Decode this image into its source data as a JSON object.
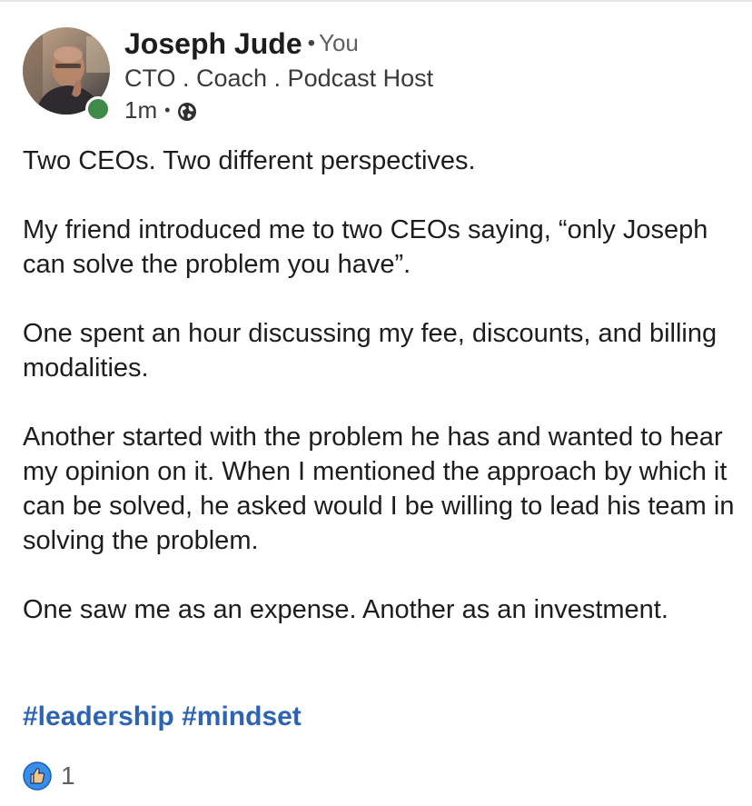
{
  "author": {
    "name": "Joseph Jude",
    "relation_sep": "•",
    "relation": "You",
    "headline": "CTO . Coach . Podcast Host",
    "time": "1m",
    "meta_sep": "•",
    "visibility_icon": "globe-icon",
    "online": true
  },
  "post": {
    "paragraphs": [
      "Two CEOs. Two different perspectives.",
      "My friend introduced me to two CEOs saying, “only Joseph can solve the problem you have”.",
      "One spent an hour discussing my fee, discounts, and billing modalities.",
      "Another started with the problem he has and wanted to hear my opinion on it. When I mentioned the approach by which it can be solved, he asked would I be willing to lead his team in solving the problem.",
      "One saw me as an expense. Another as an investment."
    ],
    "hashtags": [
      "#leadership",
      "#mindset"
    ]
  },
  "reactions": {
    "icon": "like-icon",
    "count": "1"
  },
  "colors": {
    "hashtag": "#2c64b3",
    "online": "#3f8a49",
    "like": "#378fe9"
  }
}
